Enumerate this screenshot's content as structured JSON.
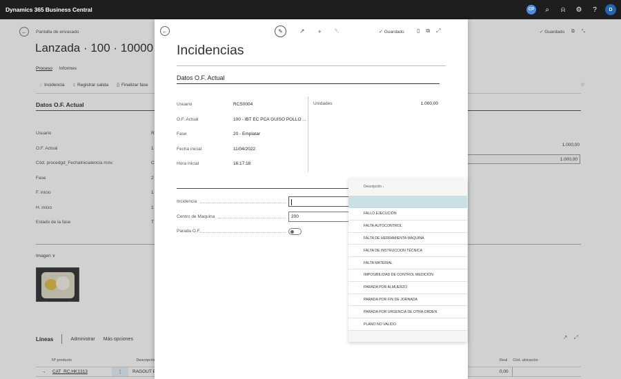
{
  "app": {
    "title": "Dynamics 365 Business Central",
    "copilot": "CP",
    "user_initial": "D"
  },
  "background_page": {
    "caption": "Pantalla de envasado",
    "title": "Lanzada · 100 · 10000 · CAT_P",
    "tabs": [
      "Proceso",
      "Informes"
    ],
    "actions": [
      "Incidencia",
      "Registrar salida",
      "Finalizar fase"
    ],
    "status": "Guardado",
    "section": "Datos O.F. Actual",
    "fields": [
      {
        "label": "Usuario",
        "value": "R"
      },
      {
        "label": "O.F. Actual",
        "value": "1"
      },
      {
        "label": "Cód. procedgd_FechaInicialencia mov.",
        "value": "C"
      },
      {
        "label": "Fase",
        "value": "2"
      },
      {
        "label": "F. inicio",
        "value": "1"
      },
      {
        "label": "H. inicio",
        "value": "1"
      },
      {
        "label": "Estado de la fase",
        "value": "T"
      }
    ],
    "right_value_1": "1.000,00",
    "right_value_2": "1.000,00",
    "image_label": "Imagen",
    "lines": {
      "title": "Líneas",
      "actions": [
        "Administrar",
        "Más opciones"
      ],
      "col_product": "Nº producto",
      "col_desc": "Descripción",
      "col_real": "Real",
      "col_loc": "Cód. ubicación",
      "row": {
        "product": "CAT_RC.HK1313",
        "desc": "RAGOUT PO",
        "real": "0,00"
      }
    }
  },
  "dialog": {
    "status": "Guardado",
    "title": "Incidencias",
    "section": "Datos O.F. Actual",
    "fields": [
      {
        "label": "Usuario",
        "value": "RCS0004"
      },
      {
        "label": "O.F. Actual",
        "value": "100 - IBT EC PCA GUISO POLLO ..."
      },
      {
        "label": "Fase",
        "value": "20 - Emplatar"
      },
      {
        "label": "Fecha inicial",
        "value": "11/04/2022"
      },
      {
        "label": "Hora inicial",
        "value": "16:17:18"
      }
    ],
    "units": {
      "label": "Unidades",
      "value": "1.000,00"
    },
    "inputs": {
      "incidencia_label": "Incidencia",
      "incidencia_value": "",
      "centro_label": "Centro de Maquina",
      "centro_value": "200",
      "parada_label": "Parada O.F."
    }
  },
  "dropdown": {
    "header": "Descripción ↓",
    "items": [
      "FALLO EJECUCIÓN",
      "FALTA AUTOCONTROL",
      "FALTA DE HERRAMIENTA MAQUINA",
      "FALTA DE INSTRUCCION TÉCNICA",
      "FALTA MATERIAL",
      "IMPOSIBILIDAD DE CONTROL MEDICIÓN",
      "PARADA POR ALMUERZO",
      "PARADA POR FIN DE JORNADA",
      "PARADA POR URGENCIA DE OTRA ORDEN",
      "PLANO NO VALIDO"
    ]
  }
}
